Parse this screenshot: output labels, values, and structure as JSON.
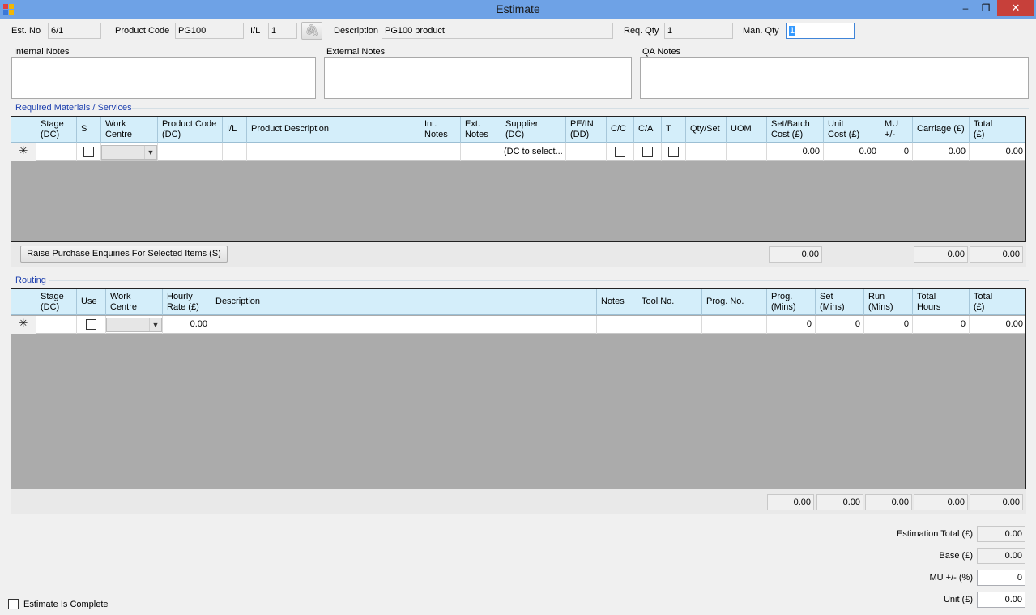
{
  "window": {
    "title": "Estimate",
    "min_glyph": "‒",
    "max_glyph": "❐",
    "close_glyph": "✕"
  },
  "header": {
    "est_no_label": "Est. No",
    "est_no": "6/1",
    "product_code_label": "Product Code",
    "product_code": "PG100",
    "il_label": "I/L",
    "il": "1",
    "attach_icon": "paperclip-icon",
    "attach_glyph": "🖇",
    "description_label": "Description",
    "description": "PG100 product",
    "req_qty_label": "Req. Qty",
    "req_qty": "1",
    "man_qty_label": "Man. Qty",
    "man_qty": "1"
  },
  "notes": {
    "internal_label": "Internal Notes",
    "external_label": "External Notes",
    "qa_label": "QA Notes"
  },
  "materials": {
    "title": "Required Materials / Services",
    "columns": [
      "",
      "Stage\n(DC)",
      "S",
      "Work\nCentre",
      "Product Code\n(DC)",
      "I/L",
      "Product Description",
      "Int.\nNotes",
      "Ext.\nNotes",
      "Supplier\n(DC)",
      "PE/IN\n(DD)",
      "C/C",
      "C/A",
      "T",
      "Qty/Set",
      "UOM",
      "Set/Batch\nCost (£)",
      "Unit\nCost (£)",
      "MU\n+/-",
      "Carriage (£)",
      "Total\n(£)"
    ],
    "new_row": {
      "marker": "✳",
      "supplier": "(DC to select...",
      "set_batch_cost": "0.00",
      "unit_cost": "0.00",
      "mu": "0",
      "carriage": "0.00",
      "total": "0.00"
    },
    "raise_button": "Raise Purchase Enquiries For Selected Items (S)",
    "totals": {
      "set_batch_cost": "0.00",
      "carriage": "0.00",
      "total": "0.00"
    }
  },
  "routing": {
    "title": "Routing",
    "columns": [
      "",
      "Stage\n(DC)",
      "Use",
      "Work\nCentre",
      "Hourly\nRate (£)",
      "Description",
      "Notes",
      "Tool No.",
      "Prog. No.",
      "Prog.\n(Mins)",
      "Set\n(Mins)",
      "Run\n(Mins)",
      "Total\nHours",
      "Total\n(£)"
    ],
    "new_row": {
      "marker": "✳",
      "hourly_rate": "0.00",
      "prog_mins": "0",
      "set_mins": "0",
      "run_mins": "0",
      "total_hours": "0",
      "total": "0.00"
    },
    "totals": [
      "0.00",
      "0.00",
      "0.00",
      "0.00",
      "0.00"
    ]
  },
  "summary": {
    "estimation_total_label": "Estimation Total (£)",
    "estimation_total": "0.00",
    "base_label": "Base (£)",
    "base": "0.00",
    "mu_label": "MU +/- (%)",
    "mu": "0",
    "unit_label": "Unit (£)",
    "unit": "0.00"
  },
  "complete_checkbox_label": "Estimate Is Complete"
}
